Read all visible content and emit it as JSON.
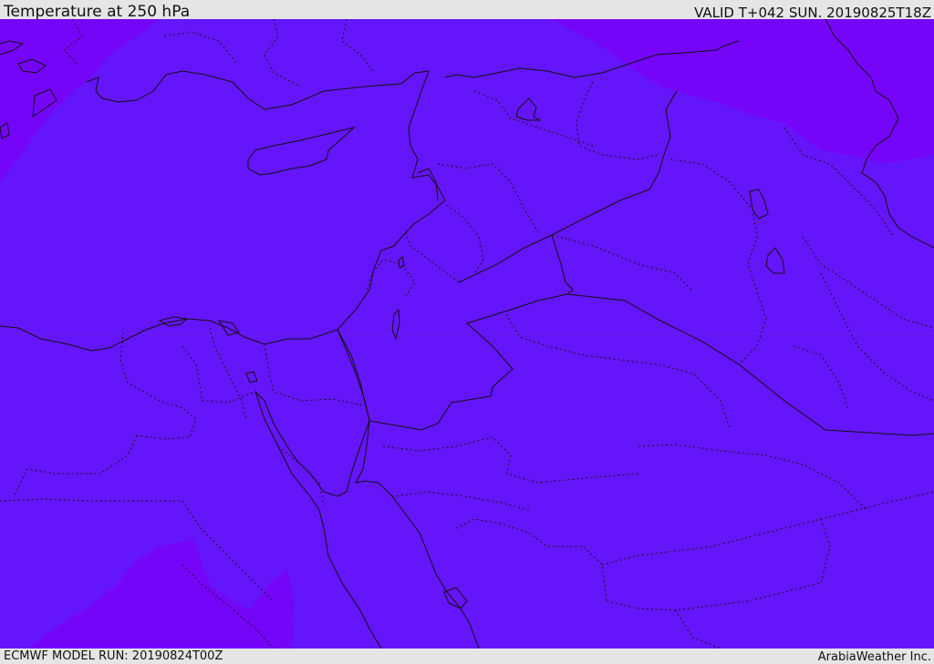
{
  "header": {
    "title": "Temperature at 250 hPa",
    "valid": "VALID T+042 SUN. 20190825T18Z"
  },
  "footer": {
    "model_run": "ECMWF MODEL RUN: 20190824T00Z",
    "credit": "ArabiaWeather Inc."
  },
  "map": {
    "colors": {
      "base_field": "#6515f9",
      "warm_field": "#7505f9",
      "coastline": "#111111",
      "border": "#1a1a1a"
    }
  }
}
